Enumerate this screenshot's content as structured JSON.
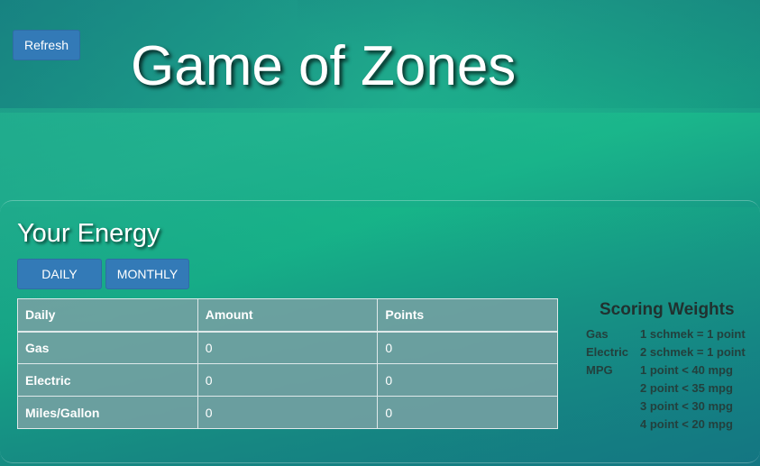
{
  "header": {
    "refresh_label": "Refresh",
    "title": "Game of Zones"
  },
  "energy": {
    "heading": "Your Energy",
    "tabs": [
      {
        "label": "DAILY"
      },
      {
        "label": "MONTHLY"
      }
    ],
    "table": {
      "columns": [
        "Daily",
        "Amount",
        "Points"
      ],
      "rows": [
        {
          "label": "Gas",
          "amount": "0",
          "points": "0"
        },
        {
          "label": "Electric",
          "amount": "0",
          "points": "0"
        },
        {
          "label": "Miles/Gallon",
          "amount": "0",
          "points": "0"
        }
      ]
    }
  },
  "scoring": {
    "title": "Scoring Weights",
    "rows": [
      {
        "key": "Gas",
        "value": "1 schmek = 1 point"
      },
      {
        "key": "Electric",
        "value": "2 schmek = 1 point"
      },
      {
        "key": "MPG",
        "value": "1 point < 40 mpg"
      },
      {
        "key": "",
        "value": "2 point < 35 mpg"
      },
      {
        "key": "",
        "value": "3 point < 30 mpg"
      },
      {
        "key": "",
        "value": "4 point < 20 mpg"
      }
    ]
  },
  "colors": {
    "button": "#337ab7",
    "table_background": "#76a0a3",
    "background_green": "#17b889",
    "background_teal": "#137c86"
  }
}
